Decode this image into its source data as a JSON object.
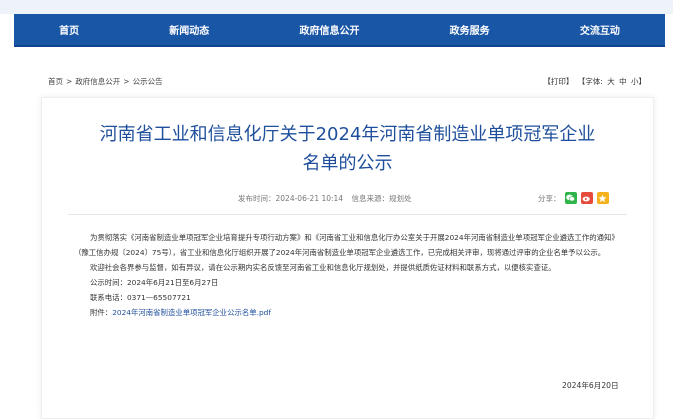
{
  "nav": [
    "首页",
    "新闻动态",
    "政府信息公开",
    "政务服务",
    "交流互动"
  ],
  "breadcrumb": [
    "首页",
    "政府信息公开",
    "公示公告"
  ],
  "breadcrumb_sep": ">",
  "tools": {
    "print": "【打印】",
    "font_label": "【字体:",
    "font_big": "大",
    "font_mid": "中",
    "font_small": "小】"
  },
  "article": {
    "title_line1": "河南省工业和信息化厅关于2024年河南省制造业单项冠军企业",
    "title_line2": "名单的公示",
    "publish_time": "发布时间：2024-06-21 10:14",
    "source": "信息来源：规划处",
    "share_label": "分享：",
    "paragraph1": "为贯彻落实《河南省制造业单项冠军企业培育提升专项行动方案》和《河南省工业和信息化厅办公室关于开展2024年河南省制造业单项冠军企业遴选工作的通知》（豫工信办规〔2024〕75号），省工业和信息化厅组织开展了2024年河南省制造业单项冠军企业遴选工作，已完成相关评审，现将通过评审的企业名单予以公示。",
    "paragraph2": "欢迎社会各界参与监督，如有异议，请在公示期内实名反馈至河南省工业和信息化厅规划处，并提供纸质佐证材料和联系方式，以便核实查证。",
    "period": "公示时间：2024年6月21日至6月27日",
    "phone": "联系电话：0371—65507721",
    "attachment_label": "附件：",
    "attachment_link": "2024年河南省制造业单项冠军企业公示名单.pdf",
    "sign_date": "2024年6月20日"
  },
  "colors": {
    "nav_bg": "#1a56a6",
    "title": "#1f4f9c",
    "link": "#1f4f9c"
  },
  "share_icons": [
    "wechat-icon",
    "weibo-icon",
    "qzone-icon"
  ]
}
